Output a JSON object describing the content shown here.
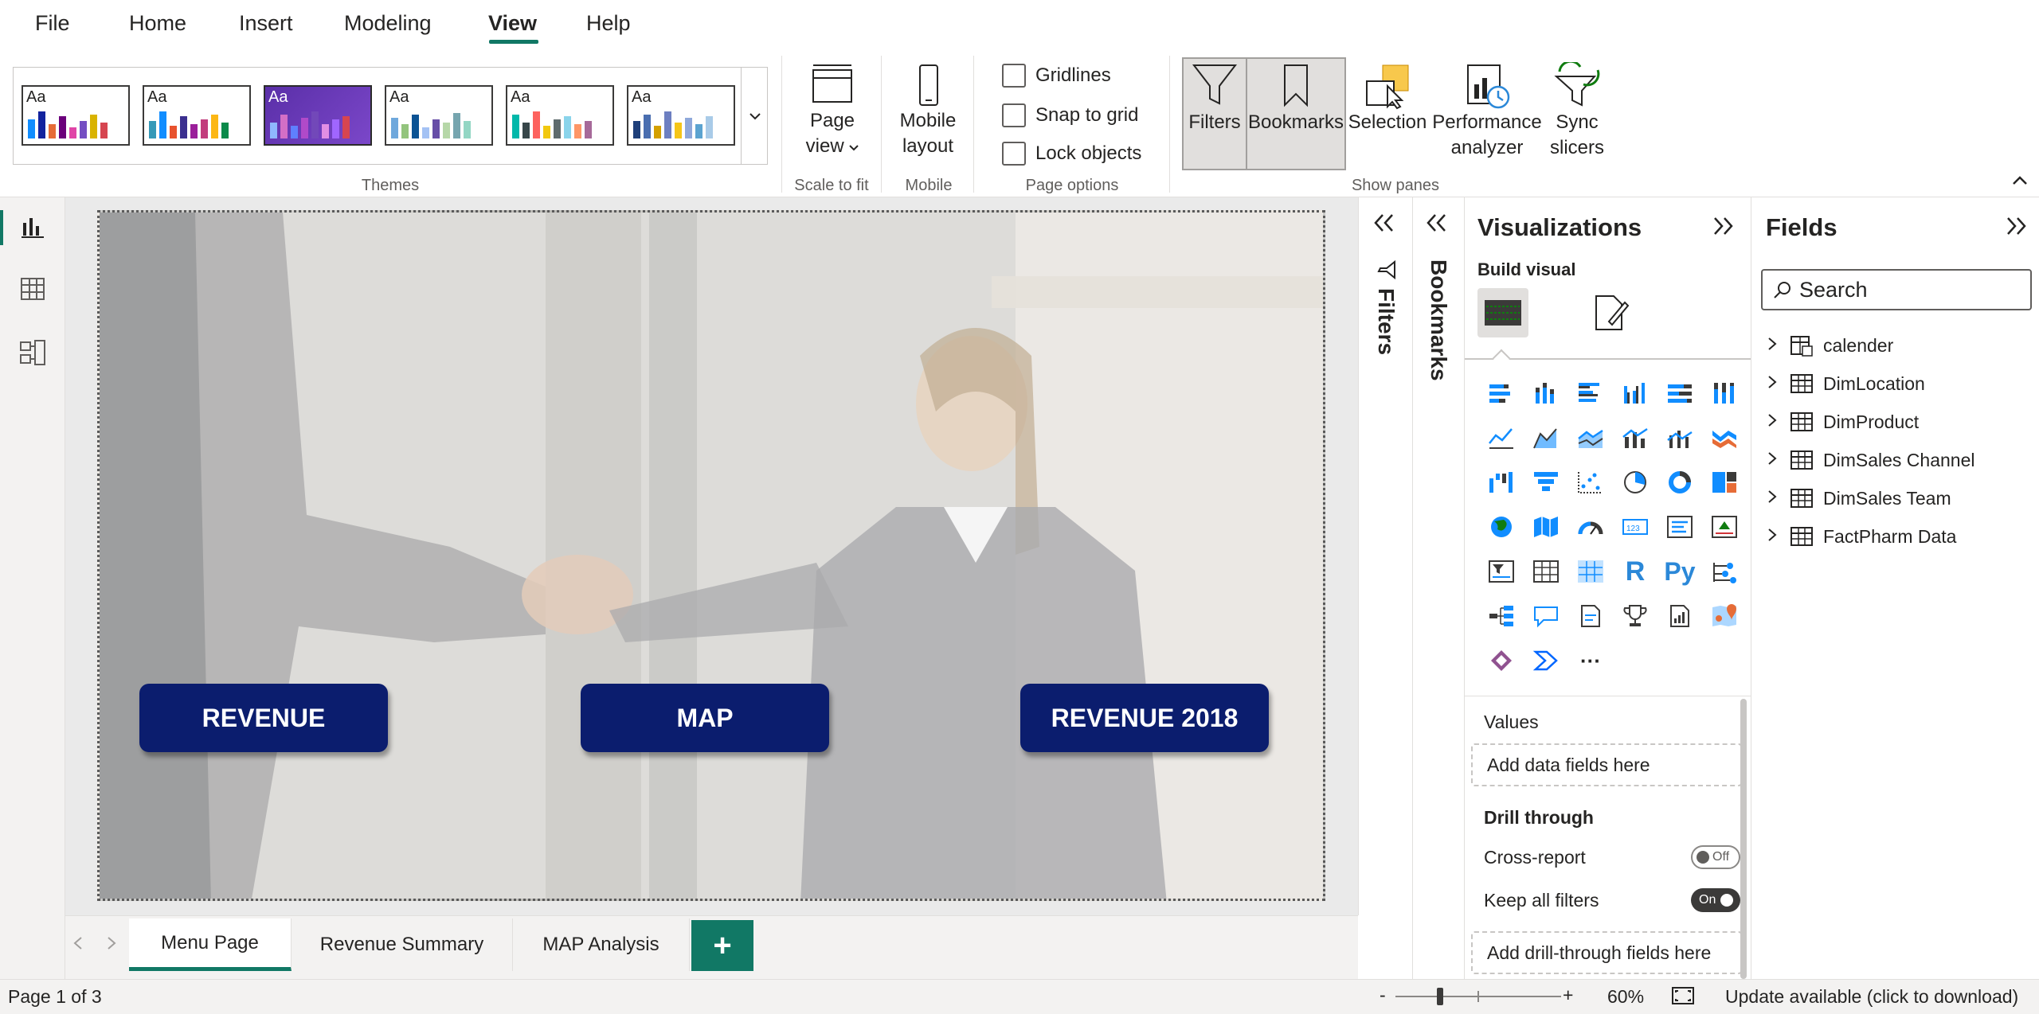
{
  "menu": {
    "items": [
      {
        "label": "File"
      },
      {
        "label": "Home"
      },
      {
        "label": "Insert"
      },
      {
        "label": "Modeling"
      },
      {
        "label": "View"
      },
      {
        "label": "Help"
      }
    ],
    "active": "View"
  },
  "ribbon": {
    "themes": {
      "group_label": "Themes",
      "swatch_text": "Aa",
      "selected_index": 2
    },
    "page_view": {
      "line1": "Page",
      "line2": "view",
      "group_label": "Scale to fit"
    },
    "mobile": {
      "line1": "Mobile",
      "line2": "layout",
      "group_label": "Mobile"
    },
    "page_options": {
      "group_label": "Page options",
      "gridlines": "Gridlines",
      "snap": "Snap to grid",
      "lock": "Lock objects"
    },
    "show_panes": {
      "group_label": "Show panes",
      "filters": "Filters",
      "bookmarks": "Bookmarks",
      "selection": "Selection",
      "performance_1": "Performance",
      "performance_2": "analyzer",
      "sync_1": "Sync",
      "sync_2": "slicers"
    }
  },
  "report": {
    "buttons": [
      {
        "label": "REVENUE"
      },
      {
        "label": "MAP"
      },
      {
        "label": "REVENUE 2018"
      }
    ]
  },
  "filters_pane": {
    "label": "Filters"
  },
  "bookmarks_pane": {
    "label": "Bookmarks"
  },
  "visualizations": {
    "title": "Visualizations",
    "build_visual": "Build visual",
    "values_label": "Values",
    "values_placeholder": "Add data fields here",
    "drill_through": "Drill through",
    "cross_report": "Cross-report",
    "cross_report_state": "Off",
    "keep_filters": "Keep all filters",
    "keep_filters_state": "On",
    "drill_placeholder": "Add drill-through fields here",
    "r_label": "R",
    "py_label": "Py",
    "more_label": "···"
  },
  "fields": {
    "title": "Fields",
    "search_placeholder": "Search",
    "tables": [
      {
        "name": "calender"
      },
      {
        "name": "DimLocation"
      },
      {
        "name": "DimProduct"
      },
      {
        "name": "DimSales Channel"
      },
      {
        "name": "DimSales Team"
      },
      {
        "name": "FactPharm Data"
      }
    ]
  },
  "tabs": {
    "pages": [
      {
        "label": "Menu Page"
      },
      {
        "label": "Revenue Summary"
      },
      {
        "label": "MAP Analysis"
      }
    ],
    "add": "+"
  },
  "status": {
    "page_info": "Page 1 of 3",
    "zoom_minus": "-",
    "zoom_plus": "+",
    "zoom": "60%",
    "update": "Update available (click to download)"
  },
  "colors": {
    "accent": "#117865",
    "button_bg": "#0b1d6e"
  }
}
